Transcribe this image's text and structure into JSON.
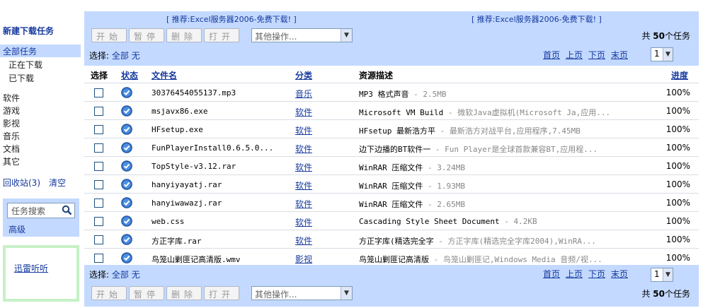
{
  "sidebar": {
    "title": "新建下载任务",
    "all_tasks": "全部任务",
    "downloading": "正在下载",
    "downloaded": "已下载",
    "categories": [
      "软件",
      "游戏",
      "影视",
      "音乐",
      "文档",
      "其它"
    ],
    "recycle": "回收站(3)",
    "clear": "清空",
    "search_placeholder": "任务搜索",
    "advanced": "高级",
    "ad_link": "迅雷听听"
  },
  "promo": {
    "left": "[ 推荐:Excel服务器2006-免费下载! ]",
    "right": "[ 推荐:Excel服务器2006-免费下载! ]"
  },
  "toolbar": {
    "start": "开始",
    "pause": "暂停",
    "delete": "删除",
    "open": "打开",
    "other_ops": "其他操作...",
    "total_prefix": "共",
    "total_count": "50",
    "total_suffix": "个任务"
  },
  "select_bar": {
    "label": "选择:",
    "all": "全部",
    "none": "无"
  },
  "pager": {
    "first": "首页",
    "prev": "上页",
    "next": "下页",
    "last": "末页",
    "page": "1"
  },
  "table": {
    "headers": {
      "select": "选择",
      "status": "状态",
      "filename": "文件名",
      "category": "分类",
      "description": "资源描述",
      "progress": "进度"
    },
    "rows": [
      {
        "filename": "30376454055137.mp3",
        "category": "音乐",
        "desc": "MP3 格式声音",
        "extra": " - 2.5MB",
        "progress": "100%"
      },
      {
        "filename": "msjavx86.exe",
        "category": "软件",
        "desc": "Microsoft VM Build",
        "extra": " - 微软Java虚拟机(Microsoft Ja,应用...",
        "progress": "100%"
      },
      {
        "filename": "HFsetup.exe",
        "category": "软件",
        "desc": "HFsetup 最新浩方平",
        "extra": " - 最新浩方对战平台,应用程序,7.45MB",
        "progress": "100%"
      },
      {
        "filename": "FunPlayerInstall0.6.5.0...",
        "category": "软件",
        "desc": "边下边播的BT软件一",
        "extra": " - Fun Player是全球首款兼容BT,应用程...",
        "progress": "100%"
      },
      {
        "filename": "TopStyle-v3.12.rar",
        "category": "软件",
        "desc": "WinRAR 压缩文件",
        "extra": " - 3.24MB",
        "progress": "100%"
      },
      {
        "filename": "hanyiyayatj.rar",
        "category": "软件",
        "desc": "WinRAR 压缩文件",
        "extra": " - 1.93MB",
        "progress": "100%"
      },
      {
        "filename": "hanyiwawazj.rar",
        "category": "软件",
        "desc": "WinRAR 压缩文件",
        "extra": " - 2.65MB",
        "progress": "100%"
      },
      {
        "filename": "web.css",
        "category": "软件",
        "desc": "Cascading Style Sheet Document",
        "extra": " - 4.2KB",
        "progress": "100%"
      },
      {
        "filename": "方正字库.rar",
        "category": "软件",
        "desc": "方正字库(精选完全字",
        "extra": " - 方正字库(精选完全字库2004),WinRA...",
        "progress": "100%"
      },
      {
        "filename": "鸟笼山剿匪记高清版.wmv",
        "category": "影视",
        "desc": "鸟笼山剿匪记高清版",
        "extra": " - 鸟笼山剿匪记,Windows Media 音频/视...",
        "progress": "100%"
      }
    ]
  }
}
